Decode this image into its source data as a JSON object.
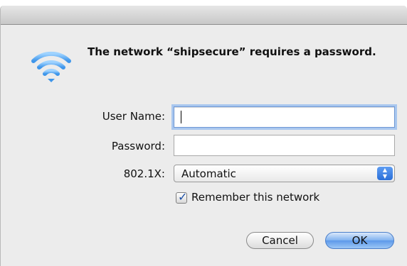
{
  "dialog": {
    "headline": "The network “shipsecure” requires a password.",
    "icon": "wifi-icon"
  },
  "form": {
    "username_label": "User Name:",
    "username_value": "",
    "password_label": "Password:",
    "password_value": "",
    "auth_label": "802.1X:",
    "auth_value": "Automatic",
    "remember_label": "Remember this network",
    "remember_checked": true
  },
  "buttons": {
    "cancel": "Cancel",
    "ok": "OK"
  },
  "colors": {
    "wifi_blue": "#5aaef4",
    "focus_ring": "#a9c7ef",
    "default_button": "#5c99ea"
  }
}
